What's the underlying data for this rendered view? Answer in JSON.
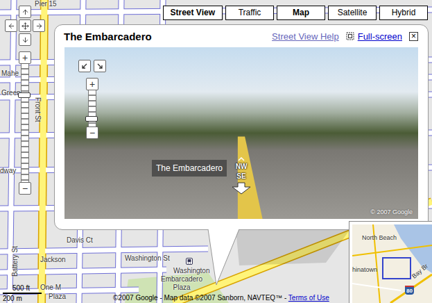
{
  "map_types": [
    {
      "label": "Street View",
      "selected": true
    },
    {
      "label": "Traffic",
      "selected": false
    },
    {
      "label": "Map",
      "selected": true
    },
    {
      "label": "Satellite",
      "selected": false
    },
    {
      "label": "Hybrid",
      "selected": false
    }
  ],
  "map_zoom": {
    "in": "+",
    "out": "−",
    "level": 0.75
  },
  "info_window": {
    "title": "The Embarcadero",
    "help_link": "Street View Help",
    "fullscreen_link": "Full-screen",
    "close": "×",
    "street_view": {
      "street_label": "The Embarcadero",
      "directions": [
        "NW",
        "SE"
      ],
      "zoom": {
        "in": "+",
        "out": "−",
        "level": 0.15
      },
      "copyright": "© 2007 Google"
    }
  },
  "street_labels": [
    "Pier 15",
    "Mahe",
    "Green",
    "dway",
    "Front St",
    "Davis Ct",
    "Jackson",
    "Washington St",
    "Washington",
    "Battery St",
    "One M",
    "Plaza",
    "Embarcadero Plaza"
  ],
  "scale": {
    "imperial": "500 ft",
    "metric": "200 m"
  },
  "copyright": {
    "text": "©2007 Google - Map data ©2007 Sanborn, NAVTEQ™ - ",
    "link": "Terms of Use"
  },
  "overview": {
    "labels": [
      "North Beach",
      "hinatown",
      "Bay Br"
    ],
    "highway": "80"
  }
}
